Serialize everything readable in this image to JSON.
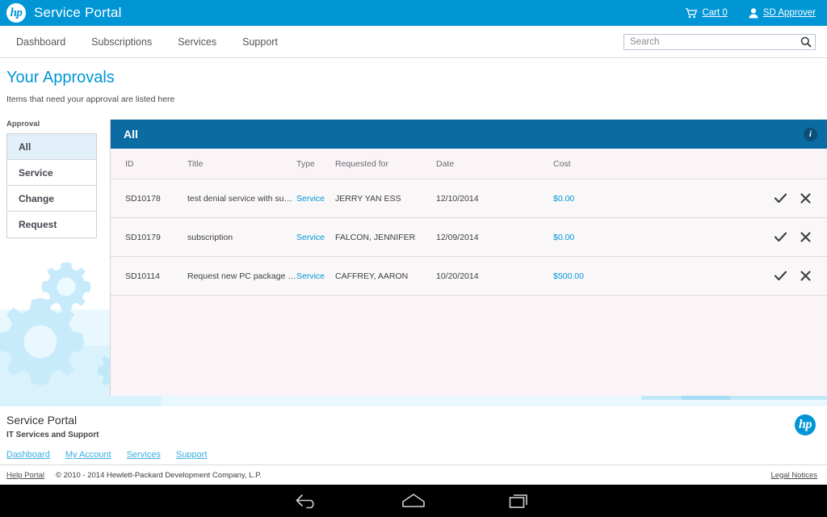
{
  "brandbar": {
    "logo_text": "hp",
    "title": "Service Portal",
    "cart_label": "Cart 0",
    "user_label": "SD Approver",
    "cart_icon": "shopping-cart-icon",
    "user_icon": "user-icon"
  },
  "nav": {
    "items": [
      {
        "label": "Dashboard"
      },
      {
        "label": "Subscriptions"
      },
      {
        "label": "Services"
      },
      {
        "label": "Support"
      }
    ]
  },
  "search": {
    "placeholder": "Search",
    "value": "",
    "icon": "search-icon"
  },
  "page": {
    "title": "Your Approvals",
    "subtitle": "Items that need your approval are listed here"
  },
  "sidebar": {
    "label": "Approval",
    "items": [
      {
        "label": "All",
        "active": true
      },
      {
        "label": "Service",
        "active": false
      },
      {
        "label": "Change",
        "active": false
      },
      {
        "label": "Request",
        "active": false
      }
    ]
  },
  "panel": {
    "title": "All",
    "info_icon": "info-icon",
    "info_glyph": "i",
    "columns": [
      {
        "label": "ID"
      },
      {
        "label": "Title"
      },
      {
        "label": "Type"
      },
      {
        "label": "Requested for"
      },
      {
        "label": "Date"
      },
      {
        "label": "Cost"
      },
      {
        "label": ""
      }
    ],
    "rows": [
      {
        "id": "SD10178",
        "title": "test denial service with subs...",
        "type": "Service",
        "requested_for": "JERRY YAN ESS",
        "date": "12/10/2014",
        "cost": "$0.00",
        "approve_icon": "check-icon",
        "reject_icon": "close-icon"
      },
      {
        "id": "SD10179",
        "title": "subscription",
        "type": "Service",
        "requested_for": "FALCON, JENNIFER",
        "date": "12/09/2014",
        "cost": "$0.00",
        "approve_icon": "check-icon",
        "reject_icon": "close-icon"
      },
      {
        "id": "SD10114",
        "title": "Request new PC package for...",
        "type": "Service",
        "requested_for": "CAFFREY, AARON",
        "date": "10/20/2014",
        "cost": "$500.00",
        "approve_icon": "check-icon",
        "reject_icon": "close-icon"
      }
    ]
  },
  "footer": {
    "title": "Service Portal",
    "subtitle": "IT Services and Support",
    "links": [
      {
        "label": "Dashboard"
      },
      {
        "label": "My Account"
      },
      {
        "label": "Services"
      },
      {
        "label": "Support"
      }
    ],
    "help_portal": "Help Portal",
    "copyright": "© 2010 - 2014 Hewlett-Packard Development Company, L.P.",
    "legal_notices": "Legal Notices",
    "logo_text": "hp"
  },
  "androidbar": {
    "back_icon": "back-arrow-icon",
    "home_icon": "home-icon",
    "recents_icon": "recent-apps-icon"
  },
  "colors": {
    "brand_blue": "#0096d6",
    "panel_blue": "#0b6ca3",
    "link_blue": "#0096d6",
    "row_bg": "#faf7f8",
    "sidebar_active": "#e2f0fa"
  }
}
